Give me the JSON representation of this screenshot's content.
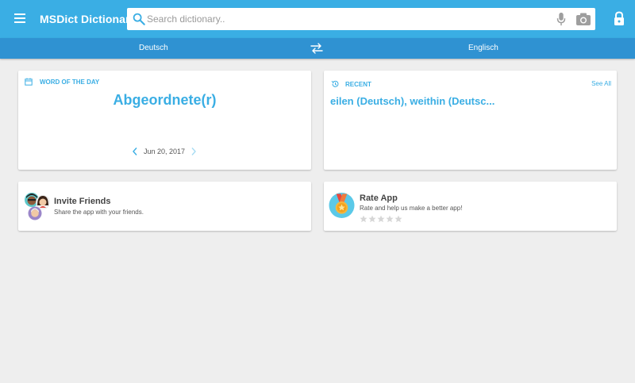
{
  "app": {
    "title": "MSDict Dictionary",
    "accent_color": "#3aaee4",
    "langbar_color": "#2f92d2"
  },
  "search": {
    "placeholder": "Search dictionary..",
    "value": ""
  },
  "languages": {
    "source": "Deutsch",
    "target": "Englisch"
  },
  "icons": {
    "menu": "hamburger-icon",
    "search": "search-icon",
    "mic": "microphone-icon",
    "camera": "camera-icon",
    "lock": "lock-icon",
    "swap": "swap-arrows-icon",
    "calendar": "calendar-icon",
    "history": "history-icon"
  },
  "word_of_the_day": {
    "heading": "WORD OF THE DAY",
    "word": "Abgeordnete(r)",
    "date": "Jun 20, 2017"
  },
  "recent": {
    "heading": "RECENT",
    "see_all": "See All",
    "words": "eilen (Deutsch), weithin (Deutsc..."
  },
  "invite": {
    "title": "Invite Friends",
    "subtitle": "Share the app with your friends."
  },
  "rate": {
    "title": "Rate App",
    "subtitle": "Rate and help us make a better app!",
    "stars_total": 5,
    "stars_filled": 0
  }
}
